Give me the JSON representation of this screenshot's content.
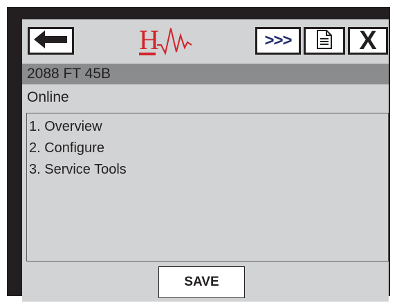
{
  "device": {
    "tag": "2088 FT 45B",
    "status": "Online"
  },
  "toolbar": {
    "back_icon": "arrow-left-icon",
    "logo_letter": "H",
    "logo_icon": "hart-logo-icon",
    "next_label": ">>>",
    "document_icon": "document-icon",
    "close_label": "X"
  },
  "menu": {
    "items": [
      {
        "label": "1. Overview"
      },
      {
        "label": "2. Configure"
      },
      {
        "label": "3. Service Tools"
      }
    ]
  },
  "actions": {
    "save_label": "SAVE"
  },
  "colors": {
    "frame": "#231f20",
    "screen": "#d1d3d4",
    "title_bar": "#8a8c8e",
    "logo_red": "#d2232a",
    "next_navy": "#1f2a6e"
  }
}
